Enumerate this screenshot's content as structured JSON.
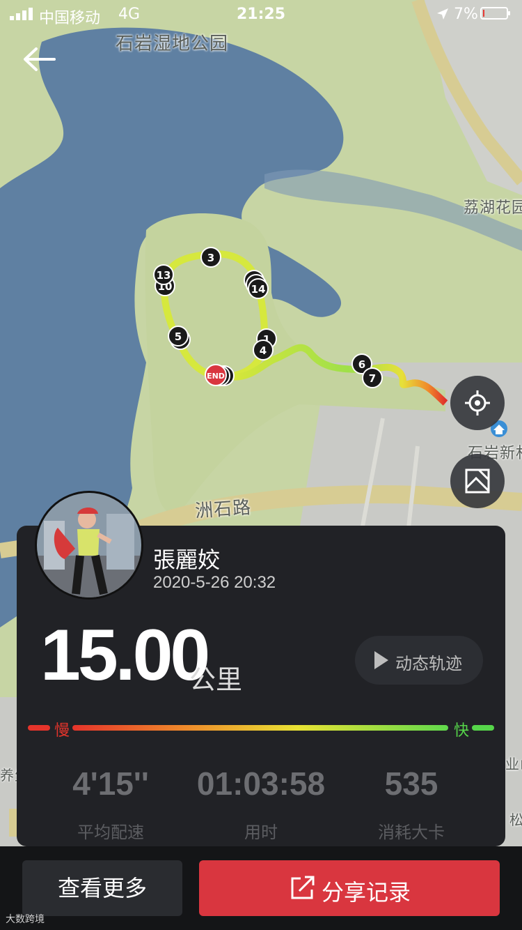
{
  "status_bar": {
    "carrier": "中国移动",
    "network": "4G",
    "time": "21:25",
    "battery": "7%",
    "battery_level": 0.07
  },
  "map": {
    "labels": [
      "石岩湿地公园",
      "荔湖花园",
      "石岩新村",
      "洲石路",
      "养生",
      "业山",
      "松"
    ],
    "route_markers": [
      "3",
      "13",
      "10",
      "14",
      "5",
      "1",
      "4",
      "6",
      "7"
    ],
    "end_marker": "END",
    "colors": {
      "water": "#5c7fa3",
      "park": "#c4d39e",
      "road": "#d9cf9a"
    }
  },
  "header": {
    "back_icon": "arrow-left-icon"
  },
  "map_controls": {
    "locate_icon": "crosshair-icon",
    "map_type_icon": "map-layer-icon"
  },
  "record": {
    "user_name": "張麗姣",
    "datetime": "2020-5-26 20:32",
    "distance": "15.00",
    "distance_unit": "公里",
    "replay_label": "动态轨迹",
    "pace_slow": "慢",
    "pace_fast": "快",
    "stats": [
      {
        "value": "4'15''",
        "label": "平均配速"
      },
      {
        "value": "01:03:58",
        "label": "用时"
      },
      {
        "value": "535",
        "label": "消耗大卡"
      }
    ]
  },
  "actions": {
    "more_label": "查看更多",
    "share_label": "分享记录"
  },
  "watermark": "大数跨境",
  "accent_colors": {
    "share": "#d9363f",
    "slow": "#e5342b",
    "fast": "#56d64a"
  }
}
